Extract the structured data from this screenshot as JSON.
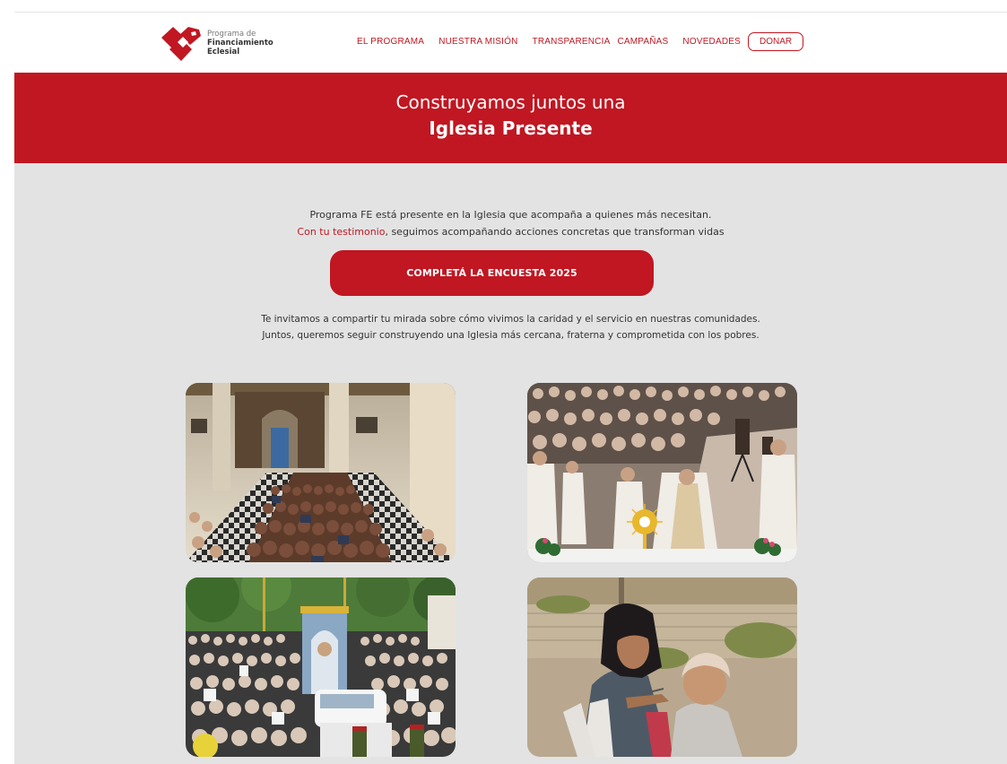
{
  "logo": {
    "line1": "Programa de",
    "line2": "Financiamiento",
    "line3": "Eclesial",
    "accent_color": "#c01722"
  },
  "nav": {
    "items": [
      {
        "label": "EL PROGRAMA"
      },
      {
        "label": "NUESTRA MISIÓN"
      },
      {
        "label": "TRANSPARENCIA"
      },
      {
        "label": "CAMPAÑAS"
      },
      {
        "label": "NOVEDADES"
      }
    ],
    "donate_label": "DONAR"
  },
  "hero": {
    "line1": "Construyamos juntos una",
    "line2": "Iglesia Presente",
    "background": "#c01722"
  },
  "intro": {
    "text1": "Programa FE está presente en la Iglesia que acompaña a quienes más necesitan.",
    "link": "Con tu testimonio",
    "text2": ", seguimos acompañando acciones concretas que transforman vidas"
  },
  "cta": {
    "label": "COMPLETÁ LA ENCUESTA 2025"
  },
  "invite": {
    "line1": "Te invitamos a compartir tu mirada sobre cómo vivimos la caridad y el servicio en nuestras comunidades.",
    "line2": "Juntos, queremos seguir construyendo una Iglesia más cercana, fraterna y comprometida con los pobres."
  },
  "colors": {
    "brand_red": "#c01722",
    "content_bg": "#e3e3e3",
    "text": "#333333"
  }
}
